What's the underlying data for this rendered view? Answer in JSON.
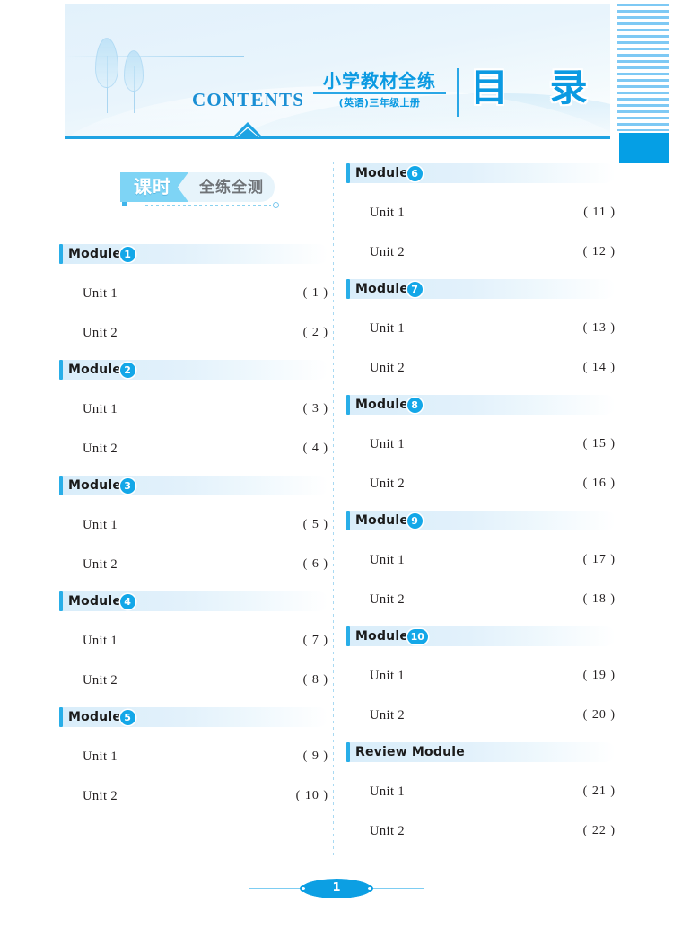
{
  "header": {
    "contents_label": "CONTENTS",
    "cn_title": "小学教材全练",
    "cn_subtitle": "(英语)三年级上册",
    "cn_mulu": "目 录"
  },
  "section_badge": {
    "flag_text": "课时",
    "text": "全练全测"
  },
  "colors": {
    "accent": "#13a7e8",
    "bar_accent": "#29aee8",
    "header_text": "#0b9ae2",
    "contents_blue": "#1a8fd4",
    "rule": "#1fa3e3",
    "stripe": "#7ec9f4",
    "edge_block": "#059fe5"
  },
  "columns": {
    "left": [
      {
        "title": "Module",
        "number": "1",
        "units": [
          {
            "name": "Unit 1",
            "page": "( 1 )"
          },
          {
            "name": "Unit 2",
            "page": "( 2 )"
          }
        ]
      },
      {
        "title": "Module",
        "number": "2",
        "units": [
          {
            "name": "Unit 1",
            "page": "( 3 )"
          },
          {
            "name": "Unit 2",
            "page": "( 4 )"
          }
        ]
      },
      {
        "title": "Module",
        "number": "3",
        "units": [
          {
            "name": "Unit 1",
            "page": "( 5 )"
          },
          {
            "name": "Unit 2",
            "page": "( 6 )"
          }
        ]
      },
      {
        "title": "Module",
        "number": "4",
        "units": [
          {
            "name": "Unit 1",
            "page": "( 7 )"
          },
          {
            "name": "Unit 2",
            "page": "( 8 )"
          }
        ]
      },
      {
        "title": "Module",
        "number": "5",
        "units": [
          {
            "name": "Unit 1",
            "page": "( 9 )"
          },
          {
            "name": "Unit 2",
            "page": "( 10 )"
          }
        ]
      }
    ],
    "right": [
      {
        "title": "Module",
        "number": "6",
        "units": [
          {
            "name": "Unit 1",
            "page": "( 11 )"
          },
          {
            "name": "Unit 2",
            "page": "( 12 )"
          }
        ]
      },
      {
        "title": "Module",
        "number": "7",
        "units": [
          {
            "name": "Unit 1",
            "page": "( 13 )"
          },
          {
            "name": "Unit 2",
            "page": "( 14 )"
          }
        ]
      },
      {
        "title": "Module",
        "number": "8",
        "units": [
          {
            "name": "Unit 1",
            "page": "( 15 )"
          },
          {
            "name": "Unit 2",
            "page": "( 16 )"
          }
        ]
      },
      {
        "title": "Module",
        "number": "9",
        "units": [
          {
            "name": "Unit 1",
            "page": "( 17 )"
          },
          {
            "name": "Unit 2",
            "page": "( 18 )"
          }
        ]
      },
      {
        "title": "Module",
        "number": "10",
        "units": [
          {
            "name": "Unit 1",
            "page": "( 19 )"
          },
          {
            "name": "Unit 2",
            "page": "( 20 )"
          }
        ]
      },
      {
        "title": "Review Module",
        "number": "",
        "units": [
          {
            "name": "Unit 1",
            "page": "( 21 )"
          },
          {
            "name": "Unit 2",
            "page": "( 22 )"
          }
        ]
      }
    ]
  },
  "footer": {
    "page_number": "1"
  }
}
